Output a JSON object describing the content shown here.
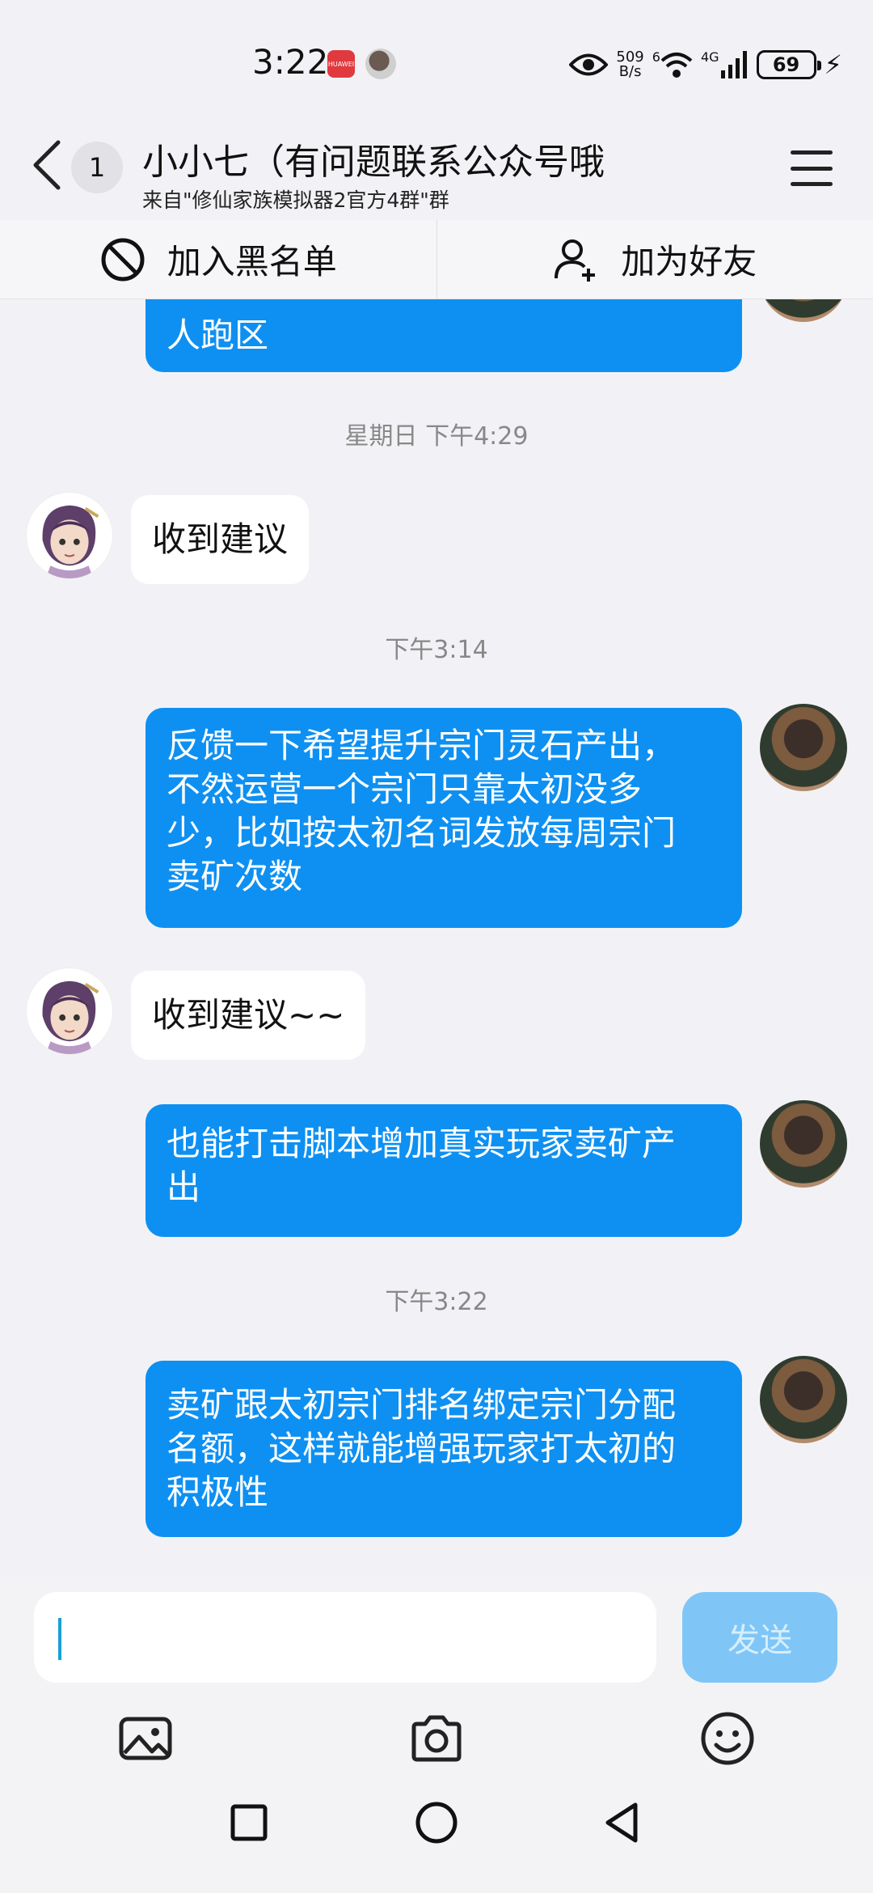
{
  "status_bar": {
    "time": "3:22",
    "app_badge": "HUAWEI",
    "net_speed_top": "509",
    "net_speed_bottom": "B/s",
    "wifi_sup": "6",
    "cell_label": "4G",
    "battery": "69"
  },
  "header": {
    "unread_count": "1",
    "title": "小小七（有问题联系公众号哦",
    "subtitle": "来自\"修仙家族模拟器2官方4群\"群"
  },
  "actions": {
    "blacklist": "加入黑名单",
    "add_friend": "加为好友"
  },
  "messages": [
    {
      "type": "out",
      "lines": [
        "人跑区"
      ]
    },
    {
      "type": "time",
      "text": "星期日 下午4:29"
    },
    {
      "type": "in",
      "lines": [
        "收到建议"
      ]
    },
    {
      "type": "time",
      "text": "下午3:14"
    },
    {
      "type": "out",
      "lines": [
        "反馈一下希望提升宗门灵石产出，",
        "不然运营一个宗门只靠太初没多",
        "少，比如按太初名词发放每周宗门",
        "卖矿次数"
      ]
    },
    {
      "type": "in",
      "lines": [
        "收到建议~~"
      ]
    },
    {
      "type": "out",
      "lines": [
        "也能打击脚本增加真实玩家卖矿产",
        "出"
      ]
    },
    {
      "type": "time",
      "text": "下午3:22"
    },
    {
      "type": "out",
      "lines": [
        "卖矿跟太初宗门排名绑定宗门分配",
        "名额，这样就能增强玩家打太初的",
        "积极性"
      ]
    }
  ],
  "composer": {
    "input_value": "",
    "send_label": "发送"
  },
  "colors": {
    "outgoing_bubble": "#0e90f2",
    "incoming_bubble": "#ffffff",
    "send_disabled": "#7fc6f7",
    "background": "#f2f2f6"
  },
  "icons": {
    "back": "chevron-left-icon",
    "menu": "hamburger-menu-icon",
    "blacklist": "block-icon",
    "add_friend": "add-person-icon",
    "image": "image-icon",
    "camera": "camera-icon",
    "emoji": "smiley-icon",
    "nav_recents": "square-icon",
    "nav_home": "circle-icon",
    "nav_back": "triangle-back-icon"
  }
}
